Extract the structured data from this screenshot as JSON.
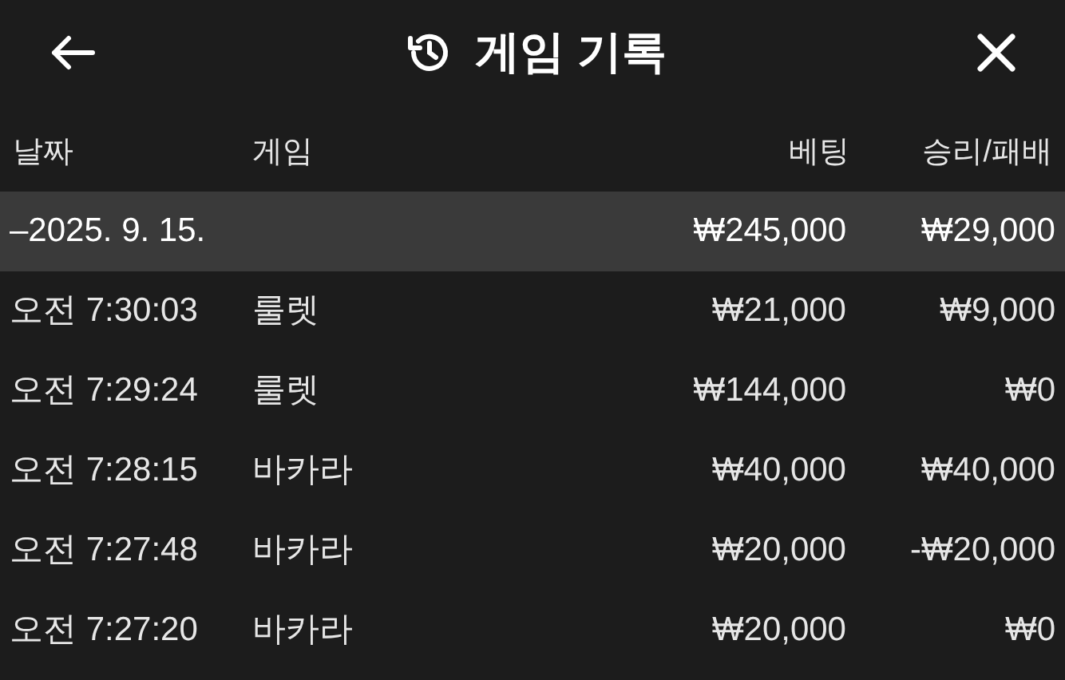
{
  "header": {
    "title": "게임 기록"
  },
  "columns": [
    "날짜",
    "게임",
    "베팅",
    "승리/패배"
  ],
  "groups": [
    {
      "label": "–2025. 9. 15.",
      "bet": "₩245,000",
      "result": "₩29,000",
      "rows": [
        {
          "time": "오전 7:30:03",
          "game": "룰렛",
          "bet": "₩21,000",
          "result": "₩9,000"
        },
        {
          "time": "오전 7:29:24",
          "game": "룰렛",
          "bet": "₩144,000",
          "result": "₩0"
        },
        {
          "time": "오전 7:28:15",
          "game": "바카라",
          "bet": "₩40,000",
          "result": "₩40,000"
        },
        {
          "time": "오전 7:27:48",
          "game": "바카라",
          "bet": "₩20,000",
          "result": "-₩20,000"
        },
        {
          "time": "오전 7:27:20",
          "game": "바카라",
          "bet": "₩20,000",
          "result": "₩0"
        }
      ]
    }
  ]
}
